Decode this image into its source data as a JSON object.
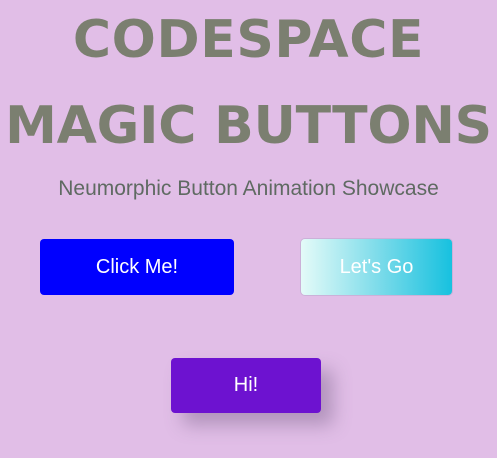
{
  "header": {
    "title_line1": "CODESPACE",
    "title_line2": "MAGIC BUTTONS",
    "subtitle": "Neumorphic Button Animation Showcase"
  },
  "buttons": {
    "click_me": "Click Me!",
    "lets_go": "Let's Go",
    "hi": "Hi!"
  },
  "colors": {
    "background": "#e1bee7",
    "title": "#7b7f70",
    "click_me_bg": "#0000ff",
    "lets_go_gradient_start": "#e4fbf8",
    "lets_go_gradient_end": "#17c1df",
    "hi_bg": "#6d12d0"
  }
}
